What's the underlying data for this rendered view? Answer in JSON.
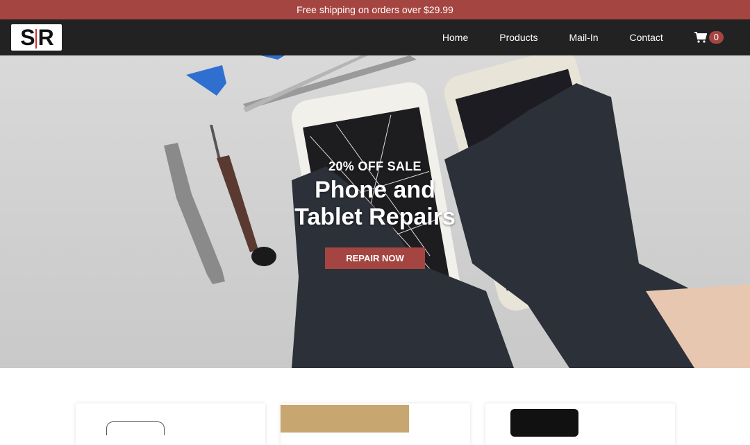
{
  "announcement": "Free shipping on orders over $29.99",
  "brand": {
    "logo_text": "SR"
  },
  "nav": {
    "links": [
      "Home",
      "Products",
      "Mail-In",
      "Contact"
    ],
    "cart_count": "0"
  },
  "hero": {
    "kicker": "20% OFF SALE",
    "title_line1": "Phone and",
    "title_line2": "Tablet Repairs",
    "button": "REPAIR NOW"
  },
  "colors": {
    "accent": "#a54541",
    "nav_bg": "#222222"
  },
  "cards": [
    "device-card",
    "box-card",
    "phone-card"
  ]
}
